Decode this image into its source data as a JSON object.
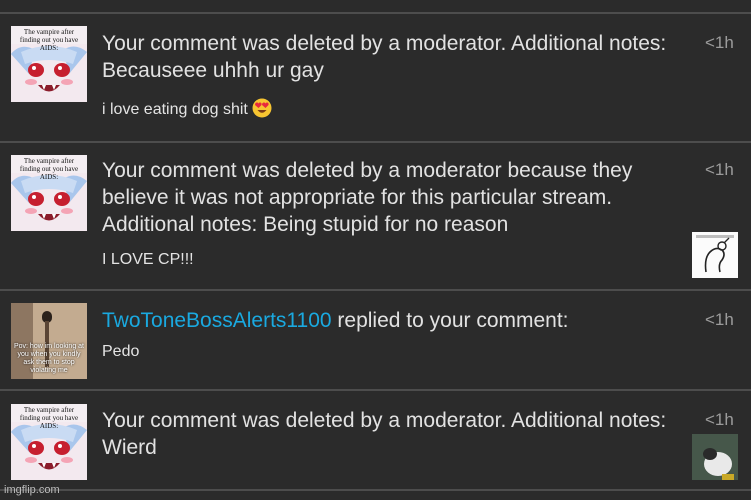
{
  "notifications": [
    {
      "avatar": {
        "icon": "vampire-anime-avatar",
        "caption": "The vampire after finding out you have AIDS:"
      },
      "message": "Your comment was deleted by a moderator. Additional notes: Becauseee uhhh ur gay",
      "comment": "i love eating dog shit",
      "emoji": "heart-eyes-emoji",
      "time": "<1h"
    },
    {
      "avatar": {
        "icon": "vampire-anime-avatar",
        "caption": "The vampire after finding out you have AIDS:"
      },
      "message": "Your comment was deleted by a moderator because they believe it was not appropriate for this particular stream. Additional notes: Being stupid for no reason",
      "comment": "I LOVE CP!!!",
      "thumbnail": "sketch-meme-thumbnail",
      "time": "<1h"
    },
    {
      "avatar": {
        "icon": "photo-avatar",
        "caption": "Pov: how im looking at you when you kindly ask them to stop violating me"
      },
      "username": "TwoToneBossAlerts1100",
      "message_suffix": " replied to your comment:",
      "comment": "Pedo",
      "time": "<1h"
    },
    {
      "avatar": {
        "icon": "vampire-anime-avatar",
        "caption": "The vampire after finding out you have AIDS:"
      },
      "message": "Your comment was deleted by a moderator. Additional notes: Wierd",
      "thumbnail": "photo-thumbnail",
      "time": "<1h"
    }
  ],
  "watermark": "imgflip.com",
  "colors": {
    "background": "#2b2b2b",
    "separator": "#4d4d4d",
    "username": "#1aa9e0",
    "text": "#e2e2e2",
    "time": "#9c9c9c"
  }
}
